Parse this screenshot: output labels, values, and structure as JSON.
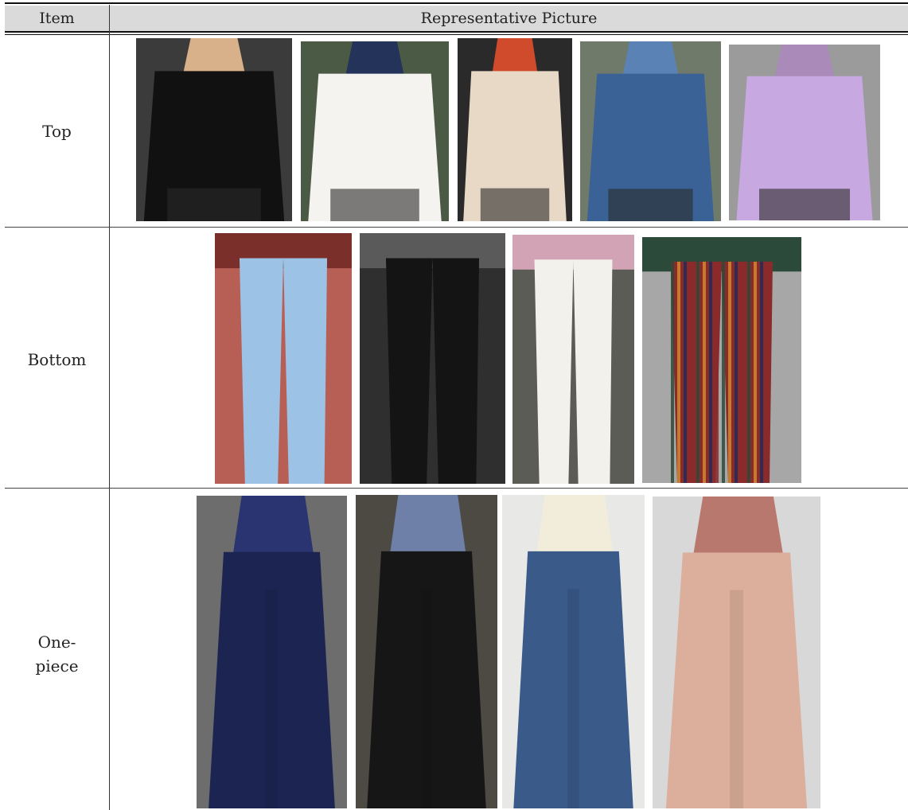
{
  "table": {
    "header": {
      "item": "Item",
      "picture": "Representative Picture"
    },
    "rows": [
      {
        "label": "Top",
        "photos": [
          {
            "name": "black-cardigan-top",
            "garment": "#111111",
            "accent": "#d8b08a",
            "bg": "#3b3b3b"
          },
          {
            "name": "white-blouse-top",
            "garment": "#f4f3ef",
            "accent": "#23335a",
            "bg": "#4b5a44"
          },
          {
            "name": "zigzag-tunic-top",
            "garment": "#e8d8c6",
            "accent": "#d04a2c",
            "bg": "#2a2a2a"
          },
          {
            "name": "blue-knit-cardigan-top",
            "garment": "#3a6296",
            "accent": "#5b82b5",
            "bg": "#6f7a6a"
          },
          {
            "name": "lilac-sweatshirt-top",
            "garment": "#c8a8e0",
            "accent": "#a98ab8",
            "bg": "#9b9b9b"
          }
        ]
      },
      {
        "label": "Bottom",
        "photos": [
          {
            "name": "light-blue-jeans-bottom",
            "garment": "#9cc2e6",
            "accent": "#7a2f2a",
            "bg": "#b85f55"
          },
          {
            "name": "black-wide-trousers-bottom",
            "garment": "#141414",
            "accent": "#5a5a5a",
            "bg": "#2f2f2f"
          },
          {
            "name": "white-jeans-bottom",
            "garment": "#f2f1ec",
            "accent": "#d1a3b4",
            "bg": "#5a5c55"
          },
          {
            "name": "striped-wide-pants-bottom",
            "garment": "#8a2a2a",
            "accent": "#2b4a3a",
            "bg": "#a7a7a7"
          }
        ]
      },
      {
        "label_lines": [
          "One-",
          "piece"
        ],
        "photos": [
          {
            "name": "navy-abaya-one-piece",
            "garment": "#1c2552",
            "accent": "#2a3470",
            "bg": "#6d6d6d"
          },
          {
            "name": "black-dress-one-piece",
            "garment": "#161616",
            "accent": "#6e7fa8",
            "bg": "#4d4a44"
          },
          {
            "name": "blue-floral-dress-one-piece",
            "garment": "#3a5a8a",
            "accent": "#f2ecda",
            "bg": "#e8e8e6"
          },
          {
            "name": "pink-tunic-dress-one-piece",
            "garment": "#dcae9c",
            "accent": "#b9786e",
            "bg": "#d8d8d8"
          }
        ]
      }
    ]
  }
}
